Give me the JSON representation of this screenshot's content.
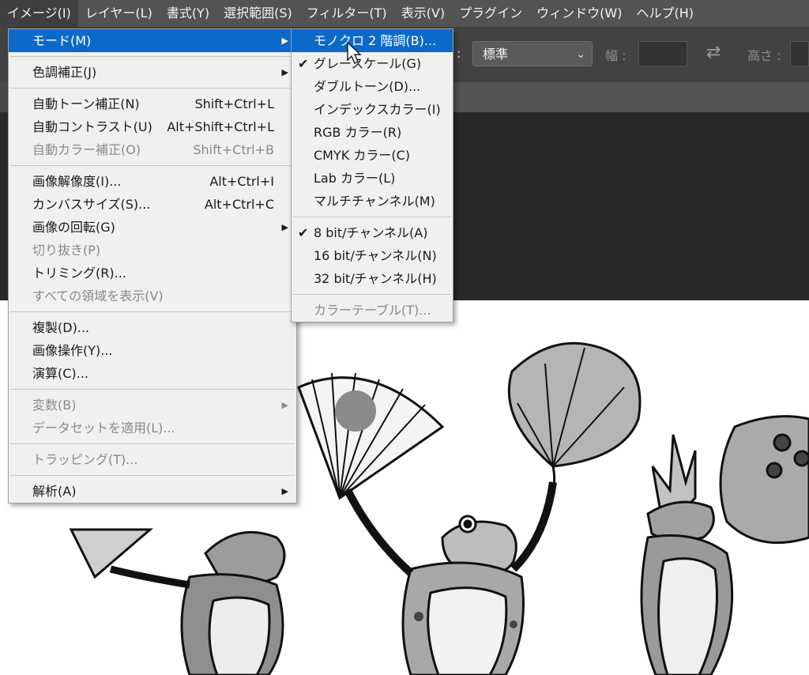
{
  "menubar": {
    "items": [
      "イメージ(I)",
      "レイヤー(L)",
      "書式(Y)",
      "選択範囲(S)",
      "フィルター(T)",
      "表示(V)",
      "プラグイン",
      "ウィンドウ(W)",
      "ヘルプ(H)"
    ]
  },
  "options": {
    "colon": ":",
    "style_value": "標準",
    "width_label": "幅 :",
    "height_label": "高さ :",
    "swap_icon": "swap-arrows-icon"
  },
  "image_menu": {
    "mode": "モード(M)",
    "adjustments": "色調補正(J)",
    "auto_tone": "自動トーン補正(N)",
    "auto_tone_sc": "Shift+Ctrl+L",
    "auto_contrast": "自動コントラスト(U)",
    "auto_contrast_sc": "Alt+Shift+Ctrl+L",
    "auto_color": "自動カラー補正(O)",
    "auto_color_sc": "Shift+Ctrl+B",
    "image_size": "画像解像度(I)...",
    "image_size_sc": "Alt+Ctrl+I",
    "canvas_size": "カンバスサイズ(S)...",
    "canvas_size_sc": "Alt+Ctrl+C",
    "rotation": "画像の回転(G)",
    "crop": "切り抜き(P)",
    "trim": "トリミング(R)...",
    "reveal_all": "すべての領域を表示(V)",
    "duplicate": "複製(D)...",
    "apply_image": "画像操作(Y)...",
    "calculations": "演算(C)...",
    "variables": "変数(B)",
    "apply_data_set": "データセットを適用(L)...",
    "trap": "トラッピング(T)...",
    "analysis": "解析(A)"
  },
  "mode_menu": {
    "bitmap": "モノクロ 2 階調(B)...",
    "grayscale": "グレースケール(G)",
    "duotone": "ダブルトーン(D)...",
    "indexed": "インデックスカラー(I)",
    "rgb": "RGB カラー(R)",
    "cmyk": "CMYK カラー(C)",
    "lab": "Lab カラー(L)",
    "multichannel": "マルチチャンネル(M)",
    "bit8": "8 bit/チャンネル(A)",
    "bit16": "16 bit/チャンネル(N)",
    "bit32": "32 bit/チャンネル(H)",
    "color_table": "カラーテーブル(T)..."
  },
  "colors": {
    "highlight": "#0b6ac9",
    "menubar_bg": "#535353",
    "menu_bg": "#f0f0f0"
  }
}
